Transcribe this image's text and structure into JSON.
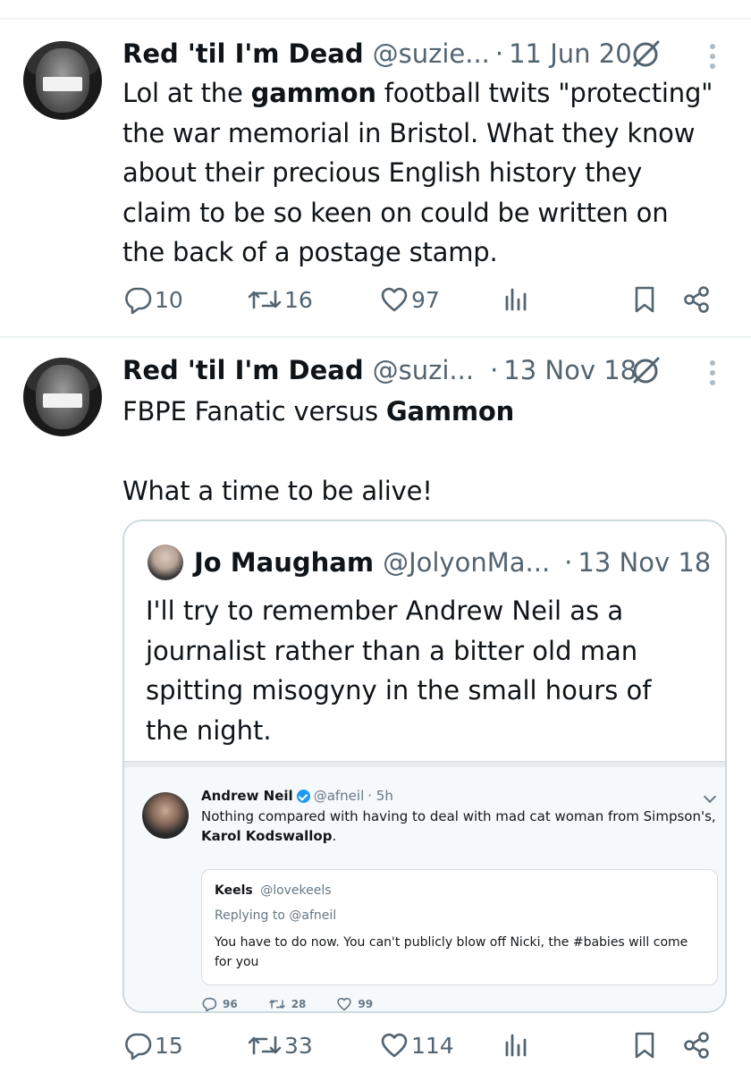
{
  "tweets": [
    {
      "name": "Red 'til I'm Dead",
      "handle": "@suzie...",
      "sep": "·",
      "date": "11 Jun 20",
      "text_lines": [
        [
          "Lol at the ",
          "gammon",
          " football twits \"protecting\""
        ],
        [
          "the war memorial in Bristol. What they know"
        ],
        [
          "about their precious English history they"
        ],
        [
          "claim to be so keen on could be written on"
        ],
        [
          "the back of a postage stamp."
        ]
      ],
      "replies": "10",
      "retweets": "16",
      "likes": "97"
    },
    {
      "name": "Red 'til I'm Dead",
      "handle": "@suzi...",
      "sep": "·",
      "date": "13 Nov 18",
      "line1_prefix": "FBPE Fanatic versus ",
      "line1_bold": "Gammon",
      "line2": "What a time to be alive!",
      "replies": "15",
      "retweets": "33",
      "likes": "114"
    }
  ],
  "quote": {
    "name": "Jo Maugham",
    "handle": "@JolyonMa...",
    "sep": "·",
    "date": "13 Nov 18",
    "lines": [
      "I'll try to remember Andrew Neil as a",
      "journalist rather than a bitter old man",
      "spitting misogyny in the small hours of",
      "the night."
    ]
  },
  "screenshot": {
    "name": "Andrew Neil",
    "handle": "@afneil",
    "time": "· 5h",
    "text_line1": "Nothing compared with having to deal with mad cat woman from Simpson's,",
    "text_line2_bold": "Karol Kodswallop",
    "text_line2_end": ".",
    "inner_name": "Keels",
    "inner_handle": "@lovekeels",
    "inner_reply": "Replying to @afneil",
    "inner_text_line1": "You have to do now. You can't publicly blow off Nicki, the #babies will come",
    "inner_text_line2": "for you",
    "replies": "96",
    "retweets": "28",
    "likes": "99"
  },
  "icons": {
    "reply": "reply-icon",
    "retweet": "retweet-icon",
    "like": "heart-icon",
    "views": "analytics-icon",
    "bookmark": "bookmark-icon",
    "share": "share-icon",
    "grok": "grok-icon",
    "more": "more-icon"
  },
  "colors": {
    "text": "#0f1419",
    "muted": "#536471",
    "divider": "#eff3f4",
    "border": "#cfd9de"
  }
}
